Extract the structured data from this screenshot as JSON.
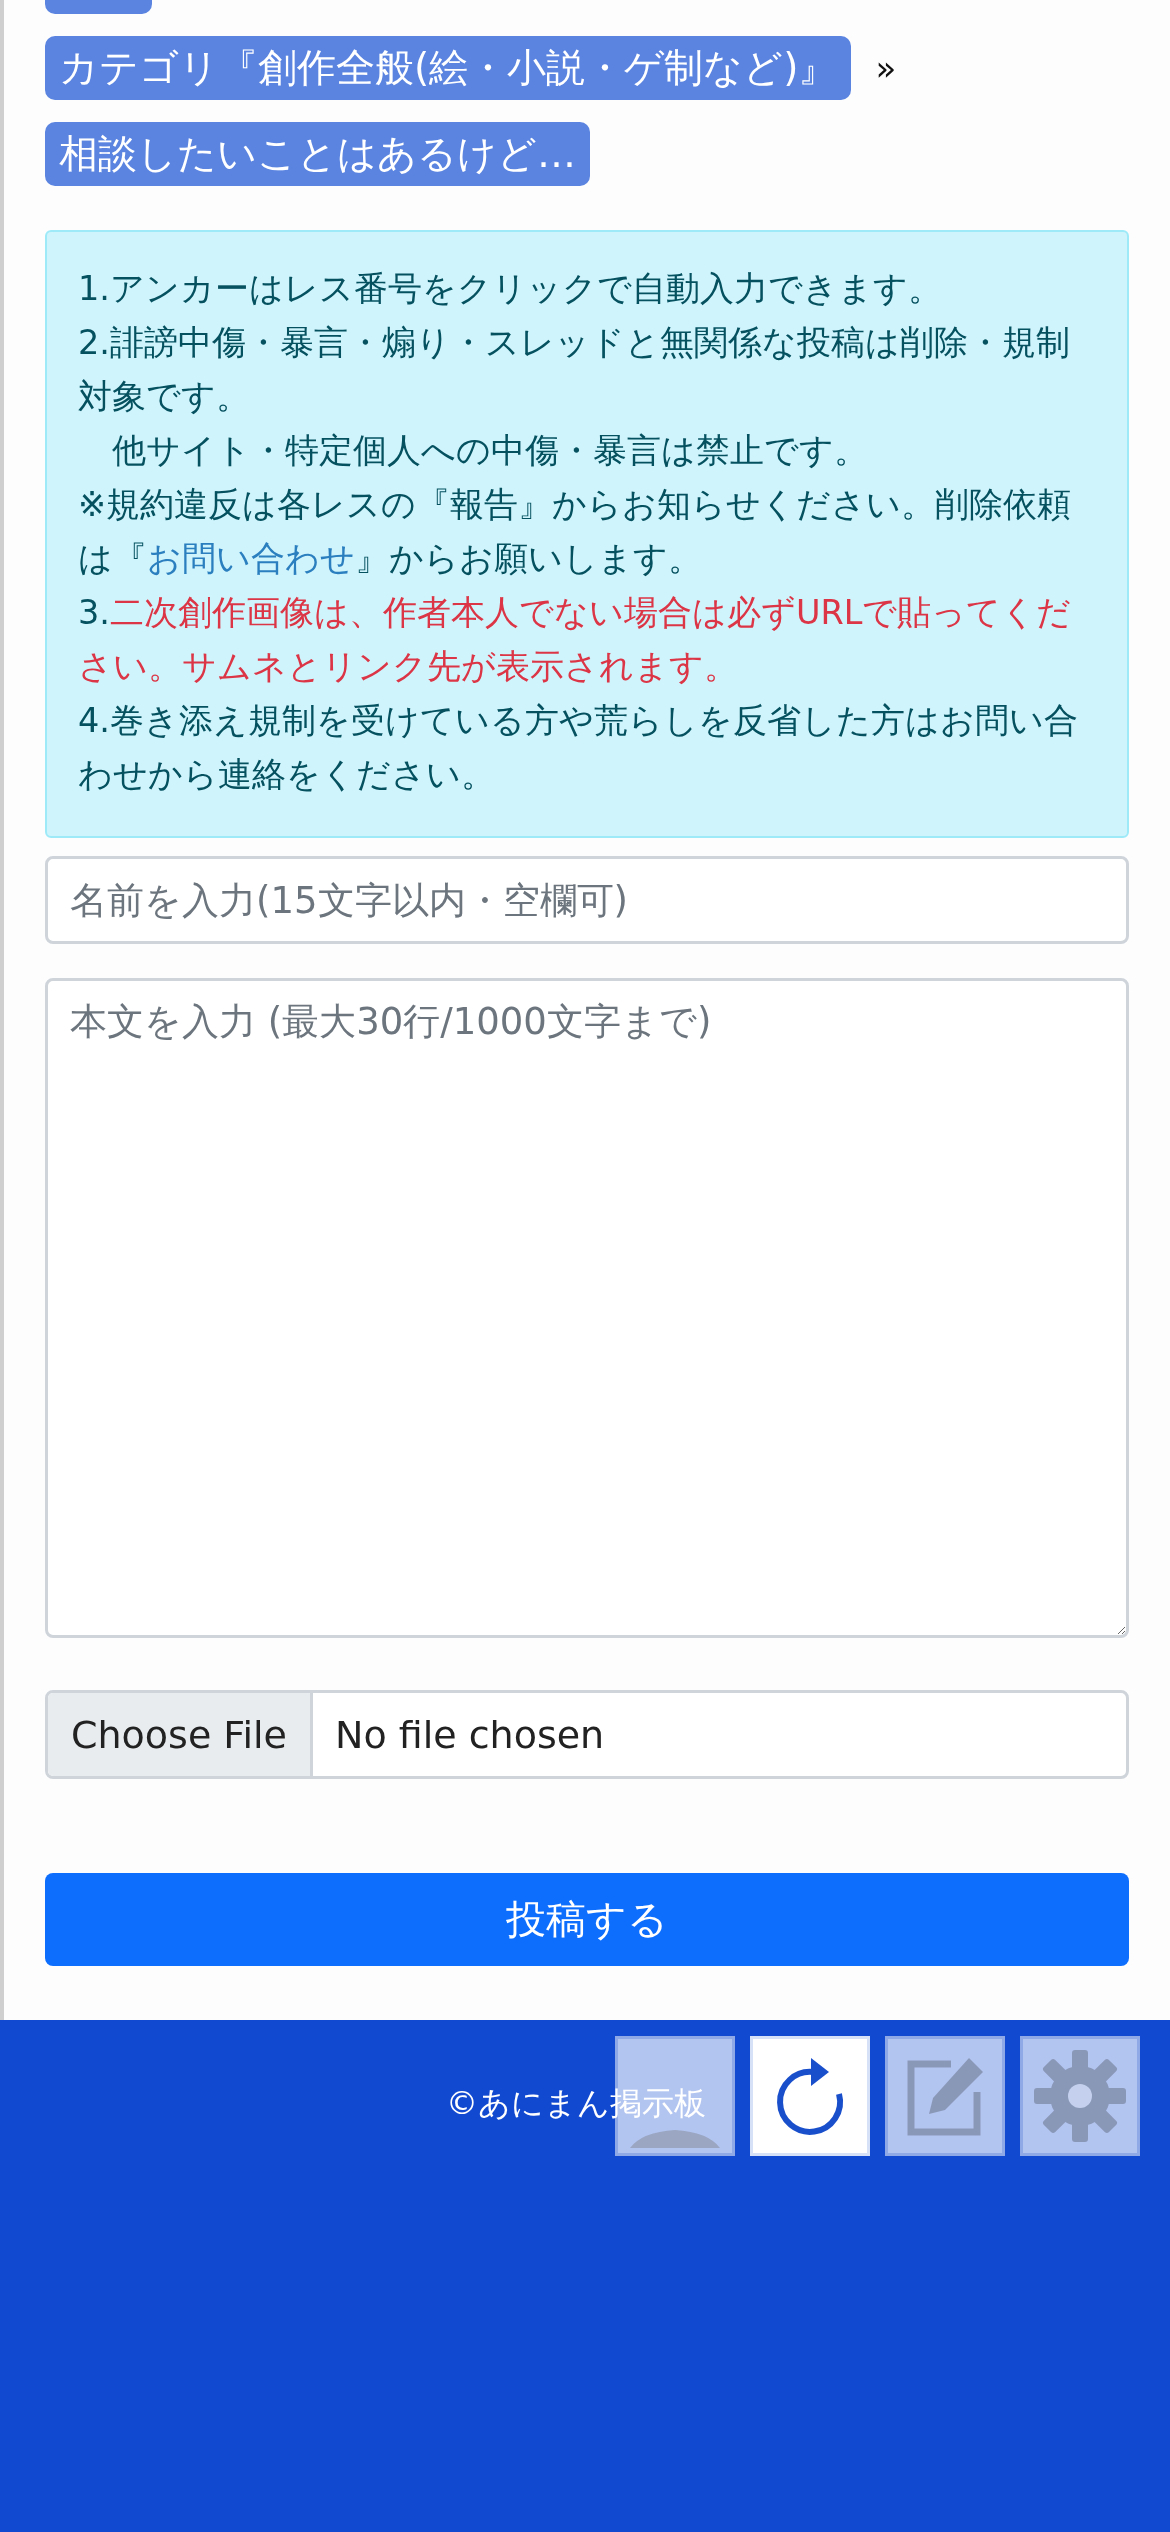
{
  "breadcrumbs": [
    {
      "label": "カテゴリ『創作全般(絵・小説・ゲ制など)』",
      "separator": "»"
    },
    {
      "label": "相談したいことはあるけど…"
    }
  ],
  "notice": [
    [
      {
        "kind": "text",
        "text": "1.アンカーはレス番号をクリックで自動入力できます。"
      }
    ],
    [
      {
        "kind": "text",
        "text": "2.誹謗中傷・暴言・煽り・スレッドと無関係な投稿は削除・規制対象です。"
      }
    ],
    [
      {
        "kind": "text",
        "text": "　他サイト・特定個人への中傷・暴言は禁止です。"
      }
    ],
    [
      {
        "kind": "text",
        "text": "※規約違反は各レスの『報告』からお知らせください。削除依頼は『"
      },
      {
        "kind": "link",
        "text": "お問い合わせ"
      },
      {
        "kind": "text",
        "text": "』からお願いします。"
      }
    ],
    [
      {
        "kind": "text",
        "text": "3."
      },
      {
        "kind": "warning",
        "text": "二次創作画像は、作者本人でない場合は必ずURLで貼ってください。サムネとリンク先が表示されます。"
      }
    ],
    [
      {
        "kind": "text",
        "text": "4.巻き添え規制を受けている方や荒らしを反省した方はお問い合わせから連絡をください。"
      }
    ]
  ],
  "form": {
    "name_placeholder": "名前を入力(15文字以内・空欄可)",
    "body_placeholder": "本文を入力 (最大30行/1000文字まで)",
    "file_button": "Choose File",
    "file_status": "No file chosen",
    "submit": "投稿する"
  },
  "footer": {
    "copyright": "©あにまん掲示板"
  },
  "float_buttons": [
    {
      "kind": "up",
      "disabled": true
    },
    {
      "kind": "reload",
      "disabled": false
    },
    {
      "kind": "edit",
      "disabled": true
    },
    {
      "kind": "settings",
      "disabled": true
    }
  ]
}
